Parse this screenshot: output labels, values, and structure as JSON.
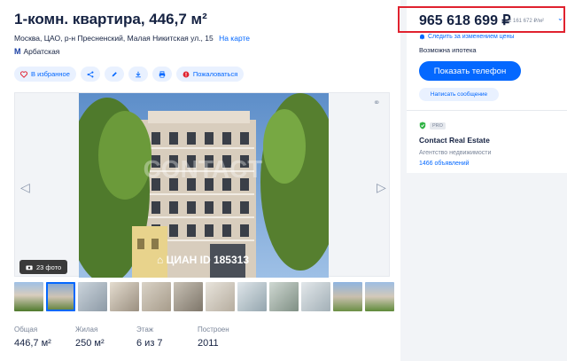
{
  "listing": {
    "title": "1-комн. квартира, 446,7 м²",
    "address": "Москва, ЦАО, р-н Пресненский, Малая Никитская ул., 15",
    "map_link": "На карте",
    "metro": "Арбатская",
    "metro_icon": "metro-icon"
  },
  "actions": {
    "favorite": "В избранное",
    "complain": "Пожаловаться"
  },
  "gallery": {
    "photo_count": "23 фото",
    "watermark_brand": "ЦИАН",
    "watermark_id": "ID 185313",
    "watermark_agency": "CONTACT REAL ESTATE"
  },
  "stats": [
    {
      "label": "Общая",
      "value": "446,7 м²"
    },
    {
      "label": "Жилая",
      "value": "250 м²"
    },
    {
      "label": "Этаж",
      "value": "6 из 7"
    },
    {
      "label": "Построен",
      "value": "2011"
    }
  ],
  "price": {
    "value": "965 618 699 ₽",
    "per_m2": "2 161 672 ₽/м²",
    "follow": "Следить за изменением цены",
    "mortgage": "Возможна ипотека",
    "show_phone": "Показать телефон",
    "message": "Написать сообщение"
  },
  "agent": {
    "pro_badge": "PRO",
    "name": "Contact Real Estate",
    "type": "Агентство недвижимости",
    "listings": "1466 объявлений"
  },
  "colors": {
    "accent": "#0468ff",
    "highlight": "#e0222f",
    "verified": "#2fb344"
  }
}
